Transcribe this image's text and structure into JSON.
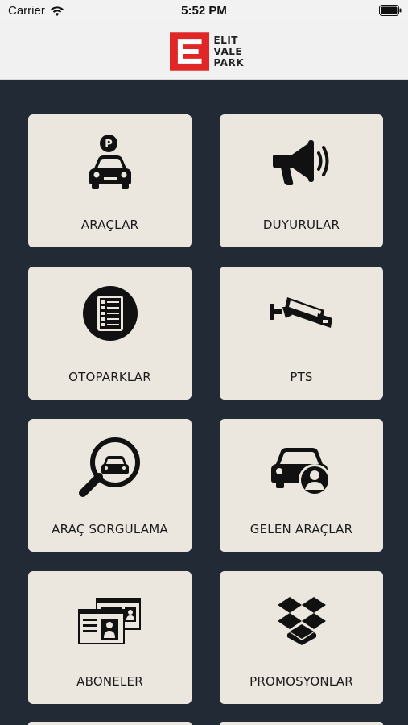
{
  "status_bar": {
    "carrier": "Carrier",
    "time": "5:52 PM"
  },
  "header": {
    "logo_line1": "ELIT",
    "logo_line2": "VALE",
    "logo_line3": "PARK",
    "brand_color": "#e02626"
  },
  "menu": [
    {
      "label": "ARAÇLAR",
      "icon": "car-parking-icon"
    },
    {
      "label": "DUYURULAR",
      "icon": "megaphone-icon"
    },
    {
      "label": "OTOPARKLAR",
      "icon": "checklist-icon"
    },
    {
      "label": "PTS",
      "icon": "security-camera-icon"
    },
    {
      "label": "ARAÇ SORGULAMA",
      "icon": "search-car-icon"
    },
    {
      "label": "GELEN ARAÇLAR",
      "icon": "car-user-icon"
    },
    {
      "label": "ABONELER",
      "icon": "id-cards-icon"
    },
    {
      "label": "PROMOSYONLAR",
      "icon": "dropbox-icon"
    }
  ],
  "colors": {
    "background": "#222a35",
    "tile": "#ece7de"
  }
}
